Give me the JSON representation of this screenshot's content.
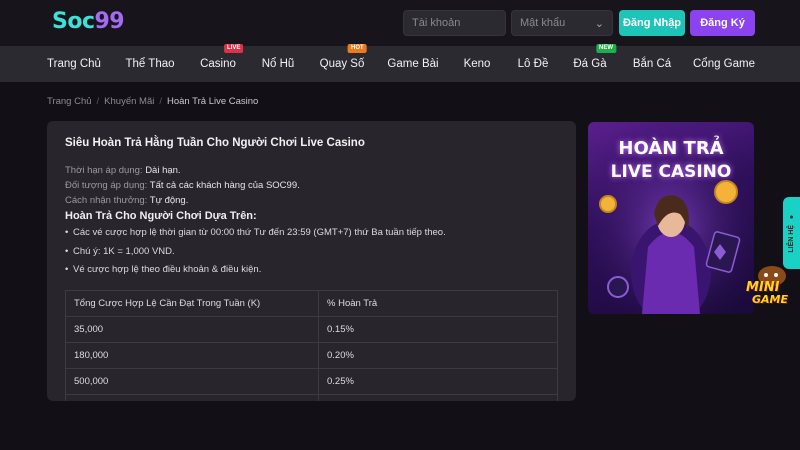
{
  "header": {
    "logo_main": "Soc",
    "logo_num": "99",
    "username_placeholder": "Tài khoản",
    "password_placeholder": "Mật khẩu",
    "login_label": "Đăng Nhập",
    "register_label": "Đăng Ký"
  },
  "nav": {
    "items": [
      {
        "label": "Trang Chủ",
        "badge": ""
      },
      {
        "label": "Thể Thao",
        "badge": ""
      },
      {
        "label": "Casino",
        "badge": "LIVE"
      },
      {
        "label": "Nổ Hũ",
        "badge": ""
      },
      {
        "label": "Quay Số",
        "badge": "HOT"
      },
      {
        "label": "Game Bài",
        "badge": ""
      },
      {
        "label": "Keno",
        "badge": ""
      },
      {
        "label": "Lô Đề",
        "badge": ""
      },
      {
        "label": "Đá Gà",
        "badge": "NEW"
      },
      {
        "label": "Bắn Cá",
        "badge": ""
      },
      {
        "label": "Cổng Game",
        "badge": ""
      }
    ]
  },
  "breadcrumb": [
    "Trang Chủ",
    "Khuyến Mãi",
    "Hoàn Trả Live Casino"
  ],
  "promo": {
    "title": "Siêu Hoàn Trả Hằng Tuần Cho Người Chơi Live Casino",
    "info": [
      {
        "label": "Thời hạn áp dụng: ",
        "value": "Dài hạn."
      },
      {
        "label": "Đối tượng áp dụng: ",
        "value": "Tất cả các khách hàng của SOC99."
      },
      {
        "label": "Cách nhận thưởng: ",
        "value": "Tự động."
      }
    ],
    "section_heading": "Hoàn Trả Cho Người Chơi Dựa Trên:",
    "bullets": [
      "Các vé cược hợp lệ thời gian từ 00:00 thứ Tư đến 23:59 (GMT+7) thứ Ba tuần tiếp theo.",
      "Chú ý: 1K = 1,000 VND.",
      "Vé cược hợp lệ theo điều khoản & điều kiện."
    ],
    "table": {
      "headers": [
        "Tổng Cược Hợp Lệ Cần Đạt Trong Tuần (K)",
        "% Hoàn Trả"
      ],
      "rows": [
        [
          "35,000",
          "0.15%"
        ],
        [
          "180,000",
          "0.20%"
        ],
        [
          "500,000",
          "0.25%"
        ]
      ]
    }
  },
  "banner": {
    "line1": "HOÀN TRẢ",
    "line2": "LIVE CASINO"
  },
  "side_tab": {
    "label": "LIÊN HỆ"
  },
  "mini_game": {
    "line1": "MINI",
    "line2": "GAME"
  },
  "colors": {
    "accent_teal": "#1ec4b8",
    "accent_purple": "#8b43f0",
    "badge_live": "#e0304a",
    "badge_hot": "#f07a1a",
    "badge_new": "#1fae4a"
  }
}
